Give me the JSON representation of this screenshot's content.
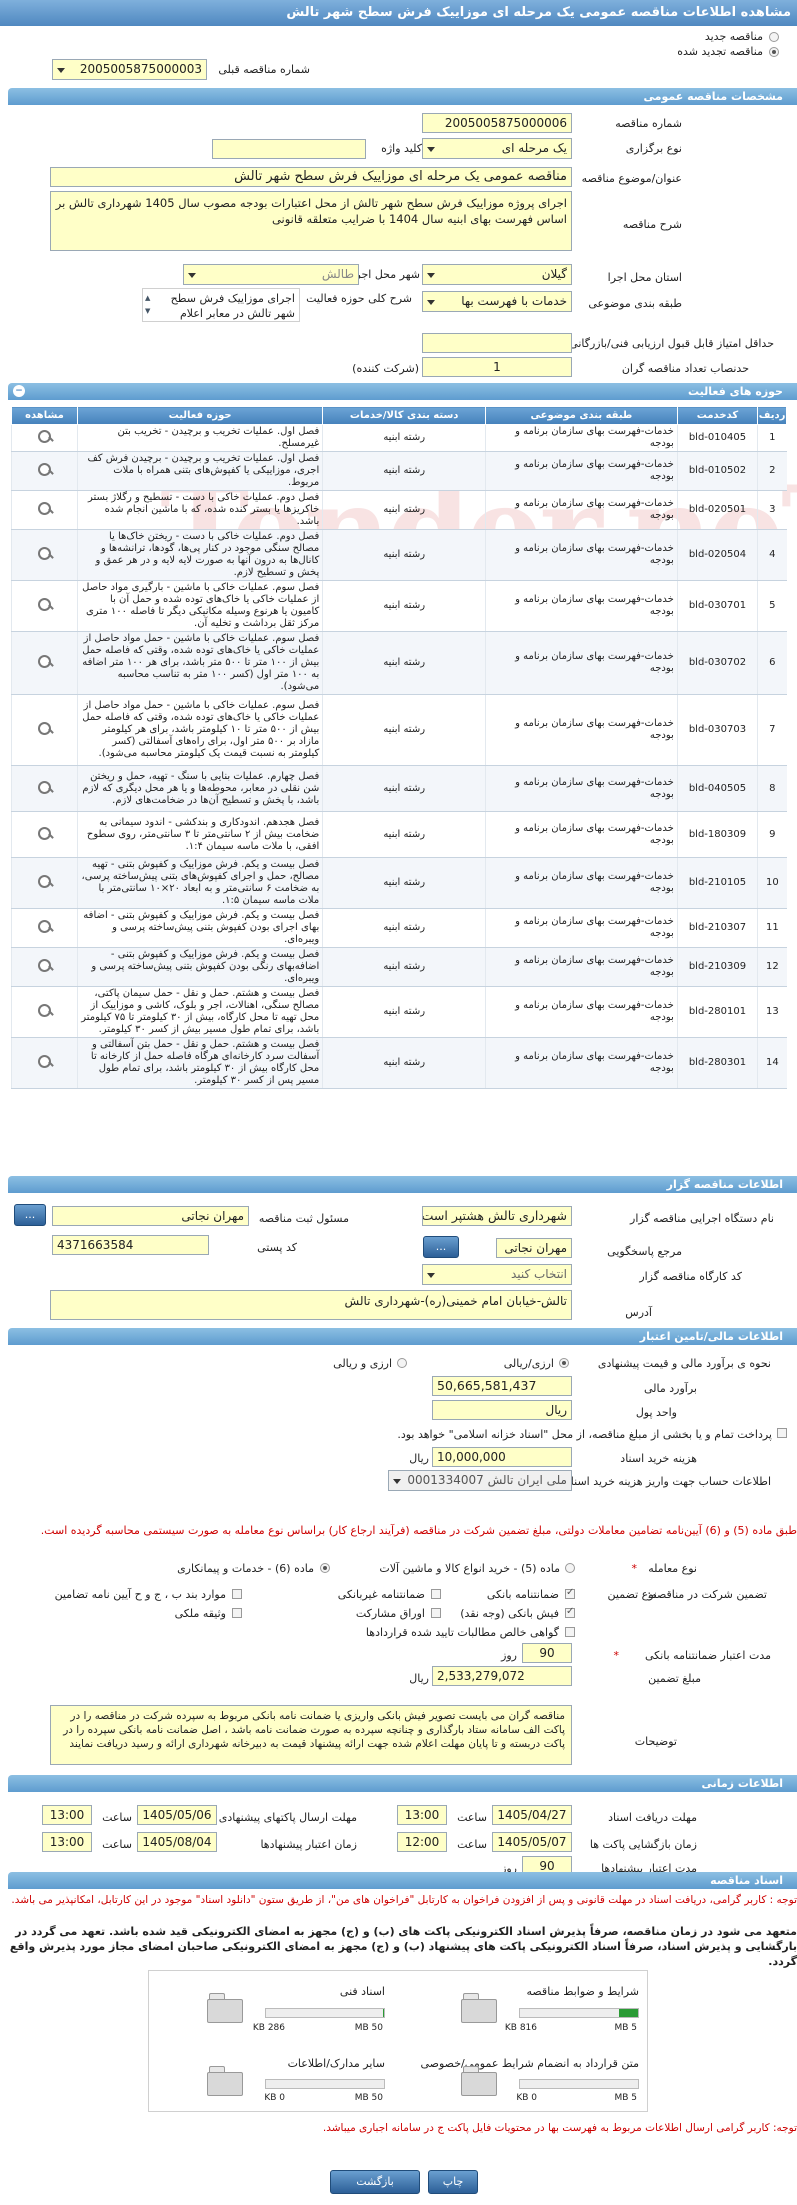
{
  "header": {
    "title": "مشاهده اطلاعات مناقصه عمومی یک مرحله ای موزاییک فرش سطح شهر تالش"
  },
  "top": {
    "new_label": "مناقصه جدید",
    "renew_label": "مناقصه تجدید شده",
    "prev_label": "شماره مناقصه قبلی",
    "prev_value": "2005005875000003"
  },
  "general": {
    "title": "مشخصات مناقصه عمومی",
    "number_label": "شماره مناقصه",
    "number": "2005005875000006",
    "type_label": "نوع برگزاری",
    "type": "یک مرحله ای",
    "keyword_label": "کلید واژه",
    "keyword": "",
    "subject_label": "عنوان/موضوع مناقصه",
    "subject": "مناقصه عمومی یک مرحله ای موزاییک فرش سطح شهر تالش",
    "desc_label": "شرح مناقصه",
    "desc": "اجرای پروژه موزاییک فرش سطح شهر تالش از محل اعتبارات بودجه مصوب سال 1405 شهرداری تالش بر اساس فهرست بهای ابنیه سال 1404 با ضرایب متعلقه قانونی",
    "province_label": "استان محل اجرا",
    "province": "گیلان",
    "city_label": "شهر محل اجرا",
    "city": "طالش",
    "category_label": "طبقه بندی موضوعی",
    "category": "خدمات با فهرست بها",
    "scope_label": "شرح کلی حوزه فعالیت",
    "scope_lines": [
      "اجرای موزاییک فرش سطح",
      "شهر تالش در معابر اعلام"
    ],
    "score_label": "حداقل امتیاز قابل قبول ارزیابی فنی/بازرگانی",
    "score": "",
    "min_label": "حدنصاب تعداد مناقصه گران",
    "min": "1",
    "min_suffix": "(شرکت کننده)"
  },
  "activities": {
    "title": "حوزه های فعالیت",
    "cols": [
      "ردیف",
      "کدخدمت",
      "طبقه بندی موضوعی",
      "دسته بندی کالا/خدمات",
      "حوزه فعالیت",
      "مشاهده"
    ],
    "rows": [
      [
        "1",
        "bld-010405",
        "خدمات-فهرست بهای سازمان برنامه و بودجه",
        "رشته ابنیه",
        "فصل اول. عملیات تخریب و برچیدن - تخریب بتن غیرمسلح."
      ],
      [
        "2",
        "bld-010502",
        "خدمات-فهرست بهای سازمان برنامه و بودجه",
        "رشته ابنیه",
        "فصل اول. عملیات تخریب و برچیدن - برچیدن فرش کف اجری، موزاییکی یا کفپوش‌های بتنی همراه با ملات مربوط."
      ],
      [
        "3",
        "bld-020501",
        "خدمات-فهرست بهای سازمان برنامه و بودجه",
        "رشته ابنیه",
        "فصل دوم. عملیات خاکی با دست - تسطیح و رگلاژ بستر خاکریزها یا بستر کنده شده، که با ماشین انجام شده باشد."
      ],
      [
        "4",
        "bld-020504",
        "خدمات-فهرست بهای سازمان برنامه و بودجه",
        "رشته ابنیه",
        "فصل دوم. عملیات خاکی با دست - ریختن خاک‌ها یا مصالح سنگی موجود در کنار پی‌ها، گودها، ترانشه‌ها و کانال‌ها به درون آنها به صورت لایه لایه و در هر عمق و پخش و تسطیح لازم."
      ],
      [
        "5",
        "bld-030701",
        "خدمات-فهرست بهای سازمان برنامه و بودجه",
        "رشته ابنیه",
        "فصل سوم. عملیات خاکی با ماشین - بارگیری مواد حاصل از عملیات خاکی یا خاک‌های توده شده و حمل آن با کامیون یا هرنوع وسیله مکانیکی دیگر تا فاصله ۱۰۰ متری مرکز ثقل برداشت و تخلیه آن."
      ],
      [
        "6",
        "bld-030702",
        "خدمات-فهرست بهای سازمان برنامه و بودجه",
        "رشته ابنیه",
        "فصل سوم. عملیات خاکی با ماشین - حمل مواد حاصل از عملیات خاکی یا خاک‌های توده شده، وقتی که فاصله حمل بیش از ۱۰۰ متر تا ۵۰۰ متر باشد، برای هر ۱۰۰ متر اضافه به ۱۰۰ متر اول (کسر ۱۰۰ متر به تناسب محاسبه می‌شود)."
      ],
      [
        "7",
        "bld-030703",
        "خدمات-فهرست بهای سازمان برنامه و بودجه",
        "رشته ابنیه",
        "فصل سوم. عملیات خاکی با ماشین - حمل مواد حاصل از عملیات خاکی یا خاک‌های توده شده، وقتی که فاصله حمل بیش از ۵۰۰ متر تا ۱۰ کیلومتر باشد، برای هر کیلومتر مازاد بر ۵۰۰ متر اول، برای راه‌های آسفالتی (کسر کیلومتر به نسبت قیمت یک کیلومتر محاسبه می‌شود)."
      ],
      [
        "8",
        "bld-040505",
        "خدمات-فهرست بهای سازمان برنامه و بودجه",
        "رشته ابنیه",
        "فصل چهارم. عملیات بنایی با سنگ - تهیه، حمل و ریختن شن نقلی در معابر، محوطه‌ها و یا هر محل دیگری که لازم باشد، با پخش و تسطیح آن‌ها در ضخامت‌های لازم."
      ],
      [
        "9",
        "bld-180309",
        "خدمات-فهرست بهای سازمان برنامه و بودجه",
        "رشته ابنیه",
        "فصل هجدهم. اندودکاری و بندکشی - اندود سیمانی به ضخامت بیش از ۲ سانتی‌متر تا ۳ سانتی‌متر، روی سطوح افقی، با ملات ماسه سیمان ۱:۴."
      ],
      [
        "10",
        "bld-210105",
        "خدمات-فهرست بهای سازمان برنامه و بودجه",
        "رشته ابنیه",
        "فصل بیست و یکم. فرش موزاییک و کفپوش بتنی - تهیه مصالح، حمل و اجرای کفپوش‌های بتنی پیش‌ساخته پرسی، به ضخامت ۶ سانتی‌متر و به ابعاد ۲۰×۱۰ سانتی‌متر با ملات ماسه سیمان ۱:۵."
      ],
      [
        "11",
        "bld-210307",
        "خدمات-فهرست بهای سازمان برنامه و بودجه",
        "رشته ابنیه",
        "فصل بیست و یکم. فرش موزاییک و کفپوش بتنی - اضافه بهای اجرای بودن کفپوش بتنی پیش‌ساخته پرسی و ویبره‌ای."
      ],
      [
        "12",
        "bld-210309",
        "خدمات-فهرست بهای سازمان برنامه و بودجه",
        "رشته ابنیه",
        "فصل بیست و یکم. فرش موزاییک و کفپوش بتنی - اضافه‌بهای رنگی بودن کفپوش بتنی پیش‌ساخته پرسی و ویبره‌ای."
      ],
      [
        "13",
        "bld-280101",
        "خدمات-فهرست بهای سازمان برنامه و بودجه",
        "رشته ابنیه",
        "فصل بیست و هشتم. حمل و نقل - حمل سیمان پاکتی، مصالح سنگی، اهنالات، اجر و بلوک، کاشی و موزاییک از محل تهیه تا محل کارگاه، بیش از ۳۰ کیلومتر تا ۷۵ کیلومتر باشد، برای تمام طول مسیر بیش از کسر ۳۰ کیلومتر."
      ],
      [
        "14",
        "bld-280301",
        "خدمات-فهرست بهای سازمان برنامه و بودجه",
        "رشته ابنیه",
        "فصل بیست و هشتم. حمل و نقل - حمل بتن آسفالتی و آسفالت سرد کارخانه‌ای هرگاه فاصله حمل از کارخانه تا محل کارگاه بیش از ۳۰ کیلومتر باشد، برای تمام طول مسیر پس از کسر ۳۰ کیلومتر."
      ]
    ]
  },
  "organizer": {
    "title": "اطلاعات مناقصه گزار",
    "org_label": "نام دستگاه اجرایی مناقصه گزار",
    "org": "شهرداری تالش هشتپر است",
    "resp_label": "مسئول ثبت مناقصه",
    "resp": "مهران نجاتی",
    "ref_label": "مرجع پاسخگویی",
    "ref": "مهران نجاتی",
    "postal_label": "کد پستی",
    "postal": "4371663584",
    "workshop_label": "کد کارگاه مناقصه گزار",
    "workshop": "انتخاب کنید",
    "address_label": "آدرس",
    "address": "تالش-خیابان امام خمینی(ره)-شهرداری تالش",
    "btn": "..."
  },
  "finance": {
    "title": "اطلاعات مالی/تامین اعتبار",
    "estimate_label": "نحوه ی برآورد مالی و قیمت پیشنهادی",
    "rial_label": "ارزی/ریالی",
    "currency_label": "ارزی و ریالی",
    "budget_label": "برآورد مالی",
    "budget": "50,665,581,437",
    "unit_label": "واحد پول",
    "unit": "ریال",
    "partial_label": "پرداخت تمام و یا بخشی از مبلغ مناقصه، از محل \"اسناد خزانه اسلامی\" خواهد بود.",
    "doc_fee_label": "هزینه خرید اسناد",
    "doc_fee": "10,000,000",
    "doc_fee_unit": "ریال",
    "account_label": "اطلاعات حساب جهت واریز هزینه خرید اسناد",
    "account": "ملی ایران تالش 0001334007",
    "note": "طبق ماده (5) و (6) آیین‌نامه تضامین معاملات دولتی، مبلغ تضمین شرکت در مناقصه (فرآیند ارجاع کار) براساس نوع معامله به صورت سیستمی محاسبه گردیده است.",
    "deal_type_label": "نوع معامله",
    "deal_opts": [
      "ماده (5) - خرید انواع کالا و ماشین آلات",
      "ماده (6) - خدمات و پیمانکاری"
    ],
    "guar_label": "تضمین شرکت در مناقصه:",
    "guar_type_label": "نوع تضمین",
    "guar_opts": [
      "ضمانتنامه بانکی",
      "ضمانتنامه غیربانکی",
      "موارد بند ب ، ج و ح آیین نامه تضامین",
      "فیش بانکی (وجه نقد)",
      "اوراق مشارکت",
      "وثیقه ملکی",
      "گواهی خالص مطالبات تایید شده قراردادها"
    ],
    "validity_label": "مدت اعتبار ضمانتنامه بانکی",
    "validity": "90",
    "validity_unit": "روز",
    "guar_amount_label": "مبلغ تضمین",
    "guar_amount": "2,533,279,072",
    "guar_unit": "ریال",
    "expl_label": "توضیحات",
    "expl": "مناقصه گران می بایست تصویر فیش بانکی واریزی یا ضمانت نامه بانکی مربوط به سپرده شرکت در مناقصه را در پاکت الف سامانه ستاد بارگذاری و چنانچه سپرده به صورت ضمانت نامه باشد ، اصل ضمانت نامه بانکی سپرده را در پاکت دربسته و تا پایان مهلت اعلام شده جهت ارائه پیشنهاد قیمت به دبیرخانه شهرداری ارائه و رسید دریافت نمایند"
  },
  "timing": {
    "title": "اطلاعات زمانی",
    "doc_deadline_label": "مهلت دریافت اسناد",
    "doc_date": "1405/04/27",
    "doc_time": "13:00",
    "send_label": "مهلت ارسال پاکتهای پیشنهادی",
    "send_date": "1405/05/06",
    "send_time": "13:00",
    "open_label": "زمان بازگشایی پاکت ها",
    "open_date": "1405/05/07",
    "open_time": "12:00",
    "valid_label": "زمان اعتبار پیشنهادها",
    "valid_date": "1405/08/04",
    "valid_time": "13:00",
    "offer_valid_label": "مدت اعتبار پیشنهادها",
    "offer_valid": "90",
    "offer_valid_unit": "روز",
    "time_label": "ساعت"
  },
  "docs": {
    "title": "اسناد مناقصه",
    "note1": "توجه : کاربر گرامی، دریافت اسناد در مهلت قانونی و پس از افزودن فراخوان به کارتابل \"فراخوان های من\"، از طریق ستون \"دانلود اسناد\" موجود در این کارتابل، امکانپذیر می باشد.",
    "note2": "متعهد می شود در زمان مناقصه، صرفاً پذیرش اسناد الکترونیکی پاکت های (ب) و (ج) مجهز به امضای الکترونیکی قید شده باشد. تعهد می گردد در بارگشایی و پذیرش اسناد، صرفاً اسناد الکترونیکی پاکت های پیشنهاد (ب) و (ج) مجهز به امضای الکترونیکی صاحبان امضای مجاز مورد پذیرش واقع گردد.",
    "files": [
      {
        "name": "شرایط و ضوابط مناقصه",
        "size": "816 KB",
        "limit": "5 MB",
        "fill": 0.16
      },
      {
        "name": "اسناد فنی",
        "size": "286 KB",
        "limit": "50 MB",
        "fill": 0.01
      },
      {
        "name": "متن قرارداد به انضمام شرایط عمومی/خصوصی",
        "size": "0 KB",
        "limit": "5 MB",
        "fill": 0
      },
      {
        "name": "سایر مدارک/اطلاعات",
        "size": "0 KB",
        "limit": "50 MB",
        "fill": 0
      }
    ],
    "note3": "توجه: کاربر گرامی ارسال اطلاعات مربوط به فهرست بها در محتویات فایل پاکت ج در سامانه اجباری میباشد."
  },
  "footer": {
    "print": "چاپ",
    "back": "بازگشت"
  }
}
